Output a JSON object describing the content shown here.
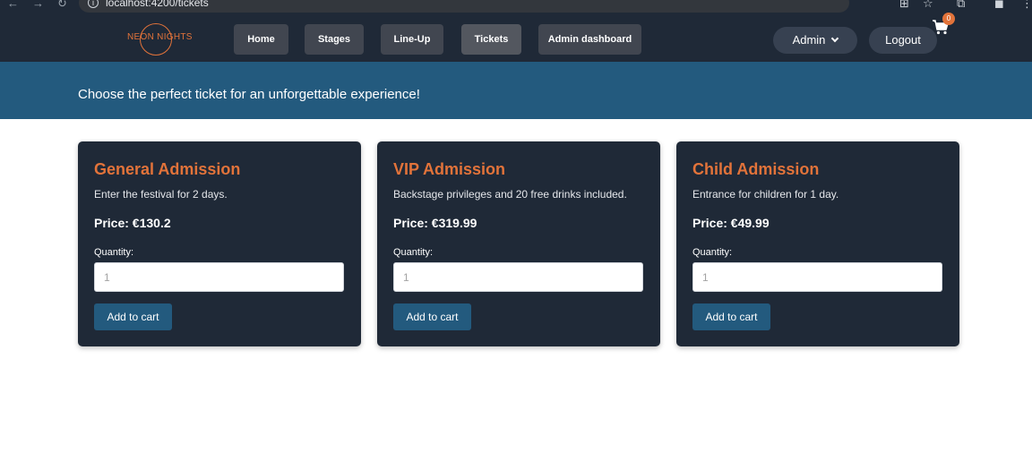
{
  "browser": {
    "url": "localhost:4200/tickets"
  },
  "navbar": {
    "logo": "NEON NIGHTS",
    "links": [
      "Home",
      "Stages",
      "Line-Up",
      "Tickets",
      "Admin dashboard"
    ],
    "active_link": "Tickets",
    "admin_label": "Admin",
    "logout_label": "Logout"
  },
  "banner": {
    "text": "Choose the perfect ticket for an unforgettable experience!",
    "cart_count": "0"
  },
  "tickets": [
    {
      "title": "General Admission",
      "description": "Enter the festival for 2 days.",
      "price": "Price: €130.2",
      "quantity_label": "Quantity:",
      "quantity_placeholder": "1",
      "button": "Add to cart"
    },
    {
      "title": "VIP Admission",
      "description": "Backstage privileges and 20 free drinks included.",
      "price": "Price: €319.99",
      "quantity_label": "Quantity:",
      "quantity_placeholder": "1",
      "button": "Add to cart"
    },
    {
      "title": "Child Admission",
      "description": "Entrance for children for 1 day.",
      "price": "Price: €49.99",
      "quantity_label": "Quantity:",
      "quantity_placeholder": "1",
      "button": "Add to cart"
    }
  ],
  "colors": {
    "navbar": "#1f2937",
    "banner": "#235a7e",
    "accent": "#e2733a",
    "card": "#1f2937"
  }
}
